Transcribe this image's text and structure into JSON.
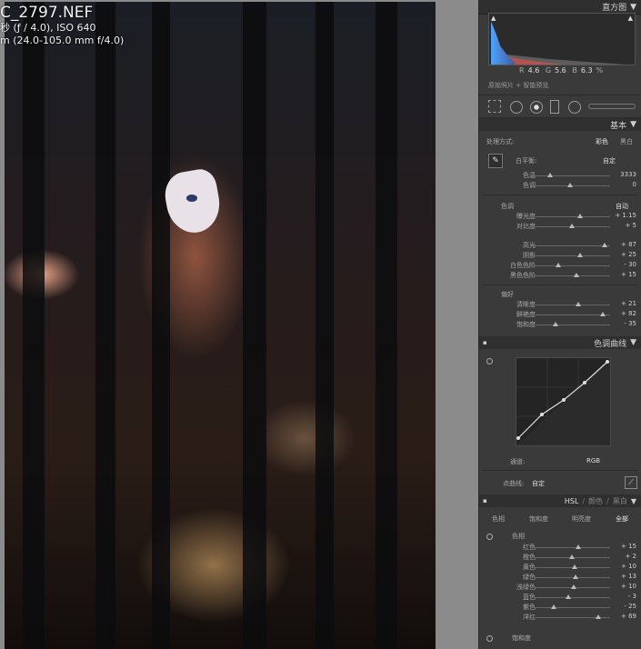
{
  "photo_overlay": {
    "filename": "C_2797.NEF",
    "exposure": "秒 (ƒ / 4.0), ISO 640",
    "lens": "m (24.0-105.0 mm f/4.0)"
  },
  "panel": {
    "histogram": {
      "title": "直方图",
      "r_label": "R",
      "r_value": "4.6",
      "g_label": "G",
      "g_value": "5.6",
      "b_label": "B",
      "b_value": "6.3",
      "unit": "%",
      "note": "原始照片 + 智能预览"
    },
    "basic": {
      "title": "基本",
      "treatment_label": "处理方式:",
      "treatment_color": "彩色",
      "treatment_bw": "黑白",
      "wb_label": "白平衡:",
      "wb_value": "自定",
      "sliders_wb": [
        {
          "label": "色温",
          "value": "3333",
          "pos": 0.25
        },
        {
          "label": "色调",
          "value": "0",
          "pos": 0.5
        }
      ],
      "tone_label": "色调",
      "tone_auto": "自动",
      "sliders_tone1": [
        {
          "label": "曝光度",
          "value": "+ 1.15",
          "pos": 0.62
        },
        {
          "label": "对比度",
          "value": "+ 5",
          "pos": 0.52
        }
      ],
      "sliders_tone2": [
        {
          "label": "高光",
          "value": "+ 87",
          "pos": 0.93
        },
        {
          "label": "阴影",
          "value": "+ 25",
          "pos": 0.62
        },
        {
          "label": "白色色阶",
          "value": "- 30",
          "pos": 0.35
        },
        {
          "label": "黑色色阶",
          "value": "+ 15",
          "pos": 0.58
        }
      ],
      "presence_label": "偏好",
      "sliders_presence": [
        {
          "label": "清晰度",
          "value": "+ 21",
          "pos": 0.6
        },
        {
          "label": "鲜艳度",
          "value": "+ 82",
          "pos": 0.91
        },
        {
          "label": "饱和度",
          "value": "- 35",
          "pos": 0.32
        }
      ]
    },
    "tone_curve": {
      "title": "色调曲线",
      "channel_label": "通道:",
      "channel_value": "RGB",
      "point_curve_label": "点曲线:",
      "point_curve_value": "自定"
    },
    "hsl": {
      "tab_hsl": "HSL",
      "tab_color": "颜色",
      "tab_bw": "黑白",
      "sub_tabs": [
        "色相",
        "饱和度",
        "明亮度",
        "全部"
      ],
      "group_label": "色相",
      "rows": [
        {
          "label": "红色",
          "value": "+ 15",
          "pos": 0.6
        },
        {
          "label": "橙色",
          "value": "+ 2",
          "pos": 0.52
        },
        {
          "label": "黄色",
          "value": "+ 10",
          "pos": 0.56
        },
        {
          "label": "绿色",
          "value": "+ 13",
          "pos": 0.57
        },
        {
          "label": "浅绿色",
          "value": "+ 10",
          "pos": 0.55
        },
        {
          "label": "蓝色",
          "value": "- 3",
          "pos": 0.48
        },
        {
          "label": "紫色",
          "value": "- 25",
          "pos": 0.3
        },
        {
          "label": "洋红",
          "value": "+ 69",
          "pos": 0.85
        }
      ],
      "group2_label": "饱和度"
    }
  }
}
